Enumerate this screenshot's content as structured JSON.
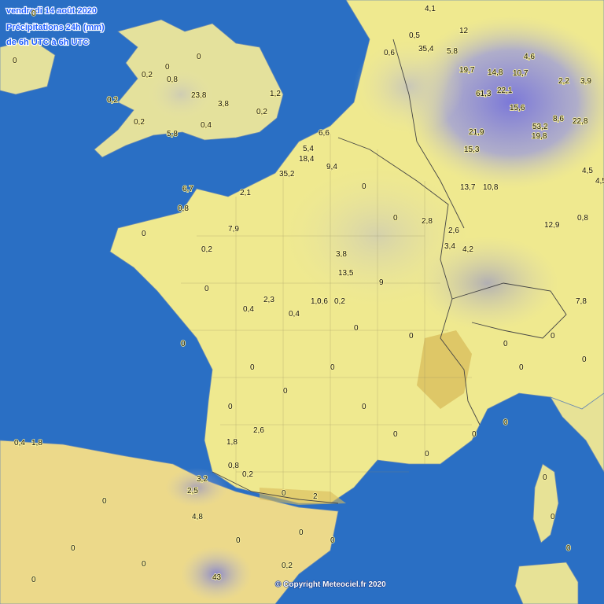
{
  "header": {
    "date": "vendredi 14 août 2020",
    "parameter": "Précipitations 24h (mm)",
    "period": "de 6h UTC à 6h UTC"
  },
  "copyright": "© Copyright Meteociel.fr 2020",
  "colors": {
    "sea": "#2a6fc4",
    "land_dry": "#f1ec8e",
    "land_light_rain": "#d9d6a8",
    "land_rain": "#8f8fd6",
    "mountain": "#d6b95a",
    "header_text": "#1f5fff"
  },
  "observations": [
    {
      "id": "s1",
      "value": "0"
    },
    {
      "id": "s2",
      "value": "0"
    },
    {
      "id": "s3",
      "value": "0,2"
    },
    {
      "id": "s4",
      "value": "0,8"
    },
    {
      "id": "s5",
      "value": "23,8"
    },
    {
      "id": "s6",
      "value": "3,8"
    },
    {
      "id": "s7",
      "value": "1,2"
    },
    {
      "id": "s8",
      "value": "0,2"
    },
    {
      "id": "s9",
      "value": "5,8"
    },
    {
      "id": "s10",
      "value": "0,4"
    },
    {
      "id": "s11",
      "value": "0,2"
    },
    {
      "id": "s12",
      "value": "0,2"
    },
    {
      "id": "s13",
      "value": "6,7"
    },
    {
      "id": "s14",
      "value": "0,8"
    },
    {
      "id": "s15",
      "value": "7,9"
    },
    {
      "id": "s16",
      "value": "2,1"
    },
    {
      "id": "s17",
      "value": "18,4"
    },
    {
      "id": "s18",
      "value": "35,2"
    },
    {
      "id": "s19",
      "value": "9,4"
    },
    {
      "id": "s20",
      "value": "6,6"
    },
    {
      "id": "s21",
      "value": "5,4"
    },
    {
      "id": "s22",
      "value": "13,5"
    },
    {
      "id": "s23",
      "value": "9"
    },
    {
      "id": "s24",
      "value": "3,8"
    },
    {
      "id": "s25",
      "value": "1,4"
    },
    {
      "id": "s26",
      "value": "0,4"
    },
    {
      "id": "s27",
      "value": "0,2"
    },
    {
      "id": "s28",
      "value": "2,3"
    },
    {
      "id": "s29",
      "value": "0,6"
    },
    {
      "id": "s30",
      "value": "0,4"
    },
    {
      "id": "s31",
      "value": "0,2"
    },
    {
      "id": "s32",
      "value": "0,8"
    },
    {
      "id": "s33",
      "value": "2,6"
    },
    {
      "id": "s34",
      "value": "1,8"
    },
    {
      "id": "s35",
      "value": "0,2"
    },
    {
      "id": "s36",
      "value": "0"
    },
    {
      "id": "s37",
      "value": "2"
    },
    {
      "id": "s38",
      "value": "4,8"
    },
    {
      "id": "s39",
      "value": "2,5"
    },
    {
      "id": "s40",
      "value": "3,2"
    },
    {
      "id": "s41",
      "value": "43"
    },
    {
      "id": "s42",
      "value": "0,2"
    },
    {
      "id": "s43",
      "value": "0,4"
    },
    {
      "id": "s44",
      "value": "1,8"
    },
    {
      "id": "s45",
      "value": "35,4"
    },
    {
      "id": "s46",
      "value": "5,8"
    },
    {
      "id": "s47",
      "value": "19,7"
    },
    {
      "id": "s48",
      "value": "14,8"
    },
    {
      "id": "s49",
      "value": "10,7"
    },
    {
      "id": "s50",
      "value": "61,3"
    },
    {
      "id": "s51",
      "value": "22,1"
    },
    {
      "id": "s52",
      "value": "15,6"
    },
    {
      "id": "s53",
      "value": "53,2"
    },
    {
      "id": "s54",
      "value": "8,6"
    },
    {
      "id": "s55",
      "value": "22,8"
    },
    {
      "id": "s56",
      "value": "19,8"
    },
    {
      "id": "s57",
      "value": "15,3"
    },
    {
      "id": "s58",
      "value": "21,9"
    },
    {
      "id": "s59",
      "value": "13,7"
    },
    {
      "id": "s60",
      "value": "10,8"
    },
    {
      "id": "s61",
      "value": "12,9"
    },
    {
      "id": "s62",
      "value": "7,8"
    },
    {
      "id": "s63",
      "value": "4,5"
    },
    {
      "id": "s64",
      "value": "0,8"
    },
    {
      "id": "s65",
      "value": "4,2"
    },
    {
      "id": "s66",
      "value": "3,4"
    },
    {
      "id": "s67",
      "value": "2,8"
    },
    {
      "id": "s68",
      "value": "0,5"
    },
    {
      "id": "s69",
      "value": "4,5"
    },
    {
      "id": "s70",
      "value": "2,6"
    },
    {
      "id": "s71",
      "value": "12"
    },
    {
      "id": "s72",
      "value": "4,6"
    },
    {
      "id": "s73",
      "value": "3,9"
    },
    {
      "id": "s74",
      "value": "4,1"
    },
    {
      "id": "s75",
      "value": "0,6"
    },
    {
      "id": "s76",
      "value": "2,2"
    },
    {
      "id": "s77",
      "value": "0"
    },
    {
      "id": "s78",
      "value": "0"
    },
    {
      "id": "s79",
      "value": "0"
    },
    {
      "id": "s80",
      "value": "0"
    },
    {
      "id": "s81",
      "value": "0"
    },
    {
      "id": "s82",
      "value": "0"
    },
    {
      "id": "s83",
      "value": "0"
    },
    {
      "id": "s84",
      "value": "0"
    },
    {
      "id": "s85",
      "value": "0"
    },
    {
      "id": "s86",
      "value": "0"
    },
    {
      "id": "s87",
      "value": "0"
    },
    {
      "id": "s88",
      "value": "0"
    },
    {
      "id": "s89",
      "value": "0"
    },
    {
      "id": "s90",
      "value": "0"
    },
    {
      "id": "s91",
      "value": "0"
    },
    {
      "id": "s92",
      "value": "0"
    },
    {
      "id": "s93",
      "value": "0"
    },
    {
      "id": "s94",
      "value": "0"
    },
    {
      "id": "s95",
      "value": "0"
    },
    {
      "id": "s96",
      "value": "0"
    },
    {
      "id": "s97",
      "value": "0"
    },
    {
      "id": "s98",
      "value": "0"
    },
    {
      "id": "s99",
      "value": "0"
    },
    {
      "id": "s100",
      "value": "0"
    },
    {
      "id": "s101",
      "value": "0"
    },
    {
      "id": "s102",
      "value": "0"
    },
    {
      "id": "s103",
      "value": "0"
    },
    {
      "id": "s104",
      "value": "0"
    },
    {
      "id": "s105",
      "value": "0"
    },
    {
      "id": "s106",
      "value": "0"
    },
    {
      "id": "s107",
      "value": "0"
    },
    {
      "id": "s108",
      "value": "0"
    }
  ]
}
